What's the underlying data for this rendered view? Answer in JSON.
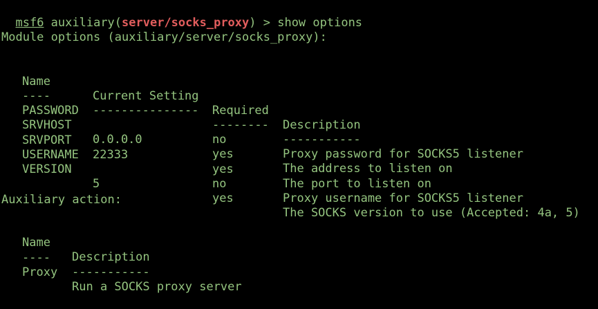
{
  "prompt": {
    "console": "msf6",
    "prefix": " auxiliary(",
    "module": "server/socks_proxy",
    "suffix": ") > ",
    "command": "show options"
  },
  "module_options": {
    "heading": "Module options (auxiliary/server/socks_proxy):",
    "headers": {
      "name": "Name",
      "setting": "Current Setting",
      "required": "Required",
      "description": "Description"
    },
    "underlines": {
      "name": "----",
      "setting": "---------------",
      "required": "--------",
      "description": "-----------"
    },
    "rows": [
      {
        "name": "PASSWORD",
        "setting": "",
        "required": "no",
        "description": "Proxy password for SOCKS5 listener"
      },
      {
        "name": "SRVHOST",
        "setting": "0.0.0.0",
        "required": "yes",
        "description": "The address to listen on"
      },
      {
        "name": "SRVPORT",
        "setting": "22333",
        "required": "yes",
        "description": "The port to listen on"
      },
      {
        "name": "USERNAME",
        "setting": "",
        "required": "no",
        "description": "Proxy username for SOCKS5 listener"
      },
      {
        "name": "VERSION",
        "setting": "5",
        "required": "yes",
        "description": "The SOCKS version to use (Accepted: 4a, 5)"
      }
    ]
  },
  "auxiliary_action": {
    "heading": "Auxiliary action:",
    "headers": {
      "name": "Name",
      "description": "Description"
    },
    "underlines": {
      "name": "----",
      "description": "-----------"
    },
    "rows": [
      {
        "name": "Proxy",
        "description": "Run a SOCKS proxy server"
      }
    ]
  },
  "colors": {
    "text": "#94c47f",
    "module": "#e25d5d",
    "background": "#000000"
  }
}
